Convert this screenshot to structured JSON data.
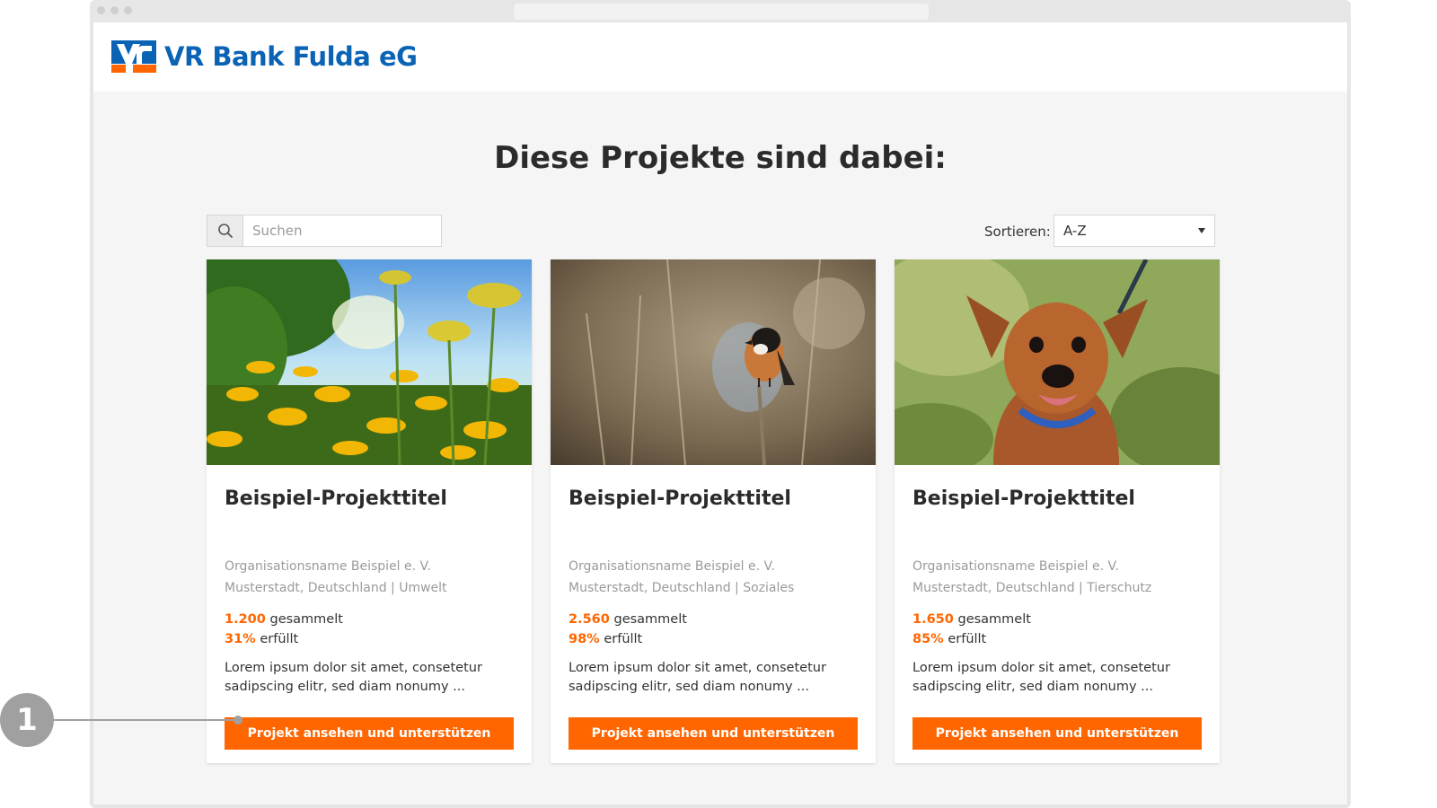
{
  "brand": {
    "name": "VR Bank Fulda eG",
    "primary_color": "#0a63b4",
    "accent_color": "#ff6600"
  },
  "page": {
    "title": "Diese Projekte sind dabei:"
  },
  "search": {
    "placeholder": "Suchen",
    "icon": "search-icon"
  },
  "sort": {
    "label": "Sortieren:",
    "selected": "A-Z"
  },
  "projects": [
    {
      "image": "flower-field",
      "title": "Beispiel-Projekttitel",
      "organization": "Organisationsname Beispiel e. V.",
      "location_category": "Musterstadt, Deutschland | Umwelt",
      "amount": "1.200",
      "amount_label": "gesammelt",
      "percent": "31%",
      "percent_label": "erfüllt",
      "description": "Lorem ipsum dolor sit amet, consetetur sadipscing elitr, sed diam nonumy ...",
      "button_label": "Projekt ansehen und unterstützen"
    },
    {
      "image": "bird",
      "title": "Beispiel-Projekttitel",
      "organization": "Organisationsname Beispiel e. V.",
      "location_category": "Musterstadt, Deutschland | Soziales",
      "amount": "2.560",
      "amount_label": "gesammelt",
      "percent": "98%",
      "percent_label": "erfüllt",
      "description": "Lorem ipsum dolor sit amet, consetetur sadipscing elitr, sed diam nonumy ...",
      "button_label": "Projekt ansehen und unterstützen"
    },
    {
      "image": "dog",
      "title": "Beispiel-Projekttitel",
      "organization": "Organisationsname Beispiel e. V.",
      "location_category": "Musterstadt, Deutschland | Tierschutz",
      "amount": "1.650",
      "amount_label": "gesammelt",
      "percent": "85%",
      "percent_label": "erfüllt",
      "description": "Lorem ipsum dolor sit amet, consetetur sadipscing elitr, sed diam nonumy ...",
      "button_label": "Projekt ansehen und unterstützen"
    }
  ],
  "callout": {
    "number": "1"
  }
}
